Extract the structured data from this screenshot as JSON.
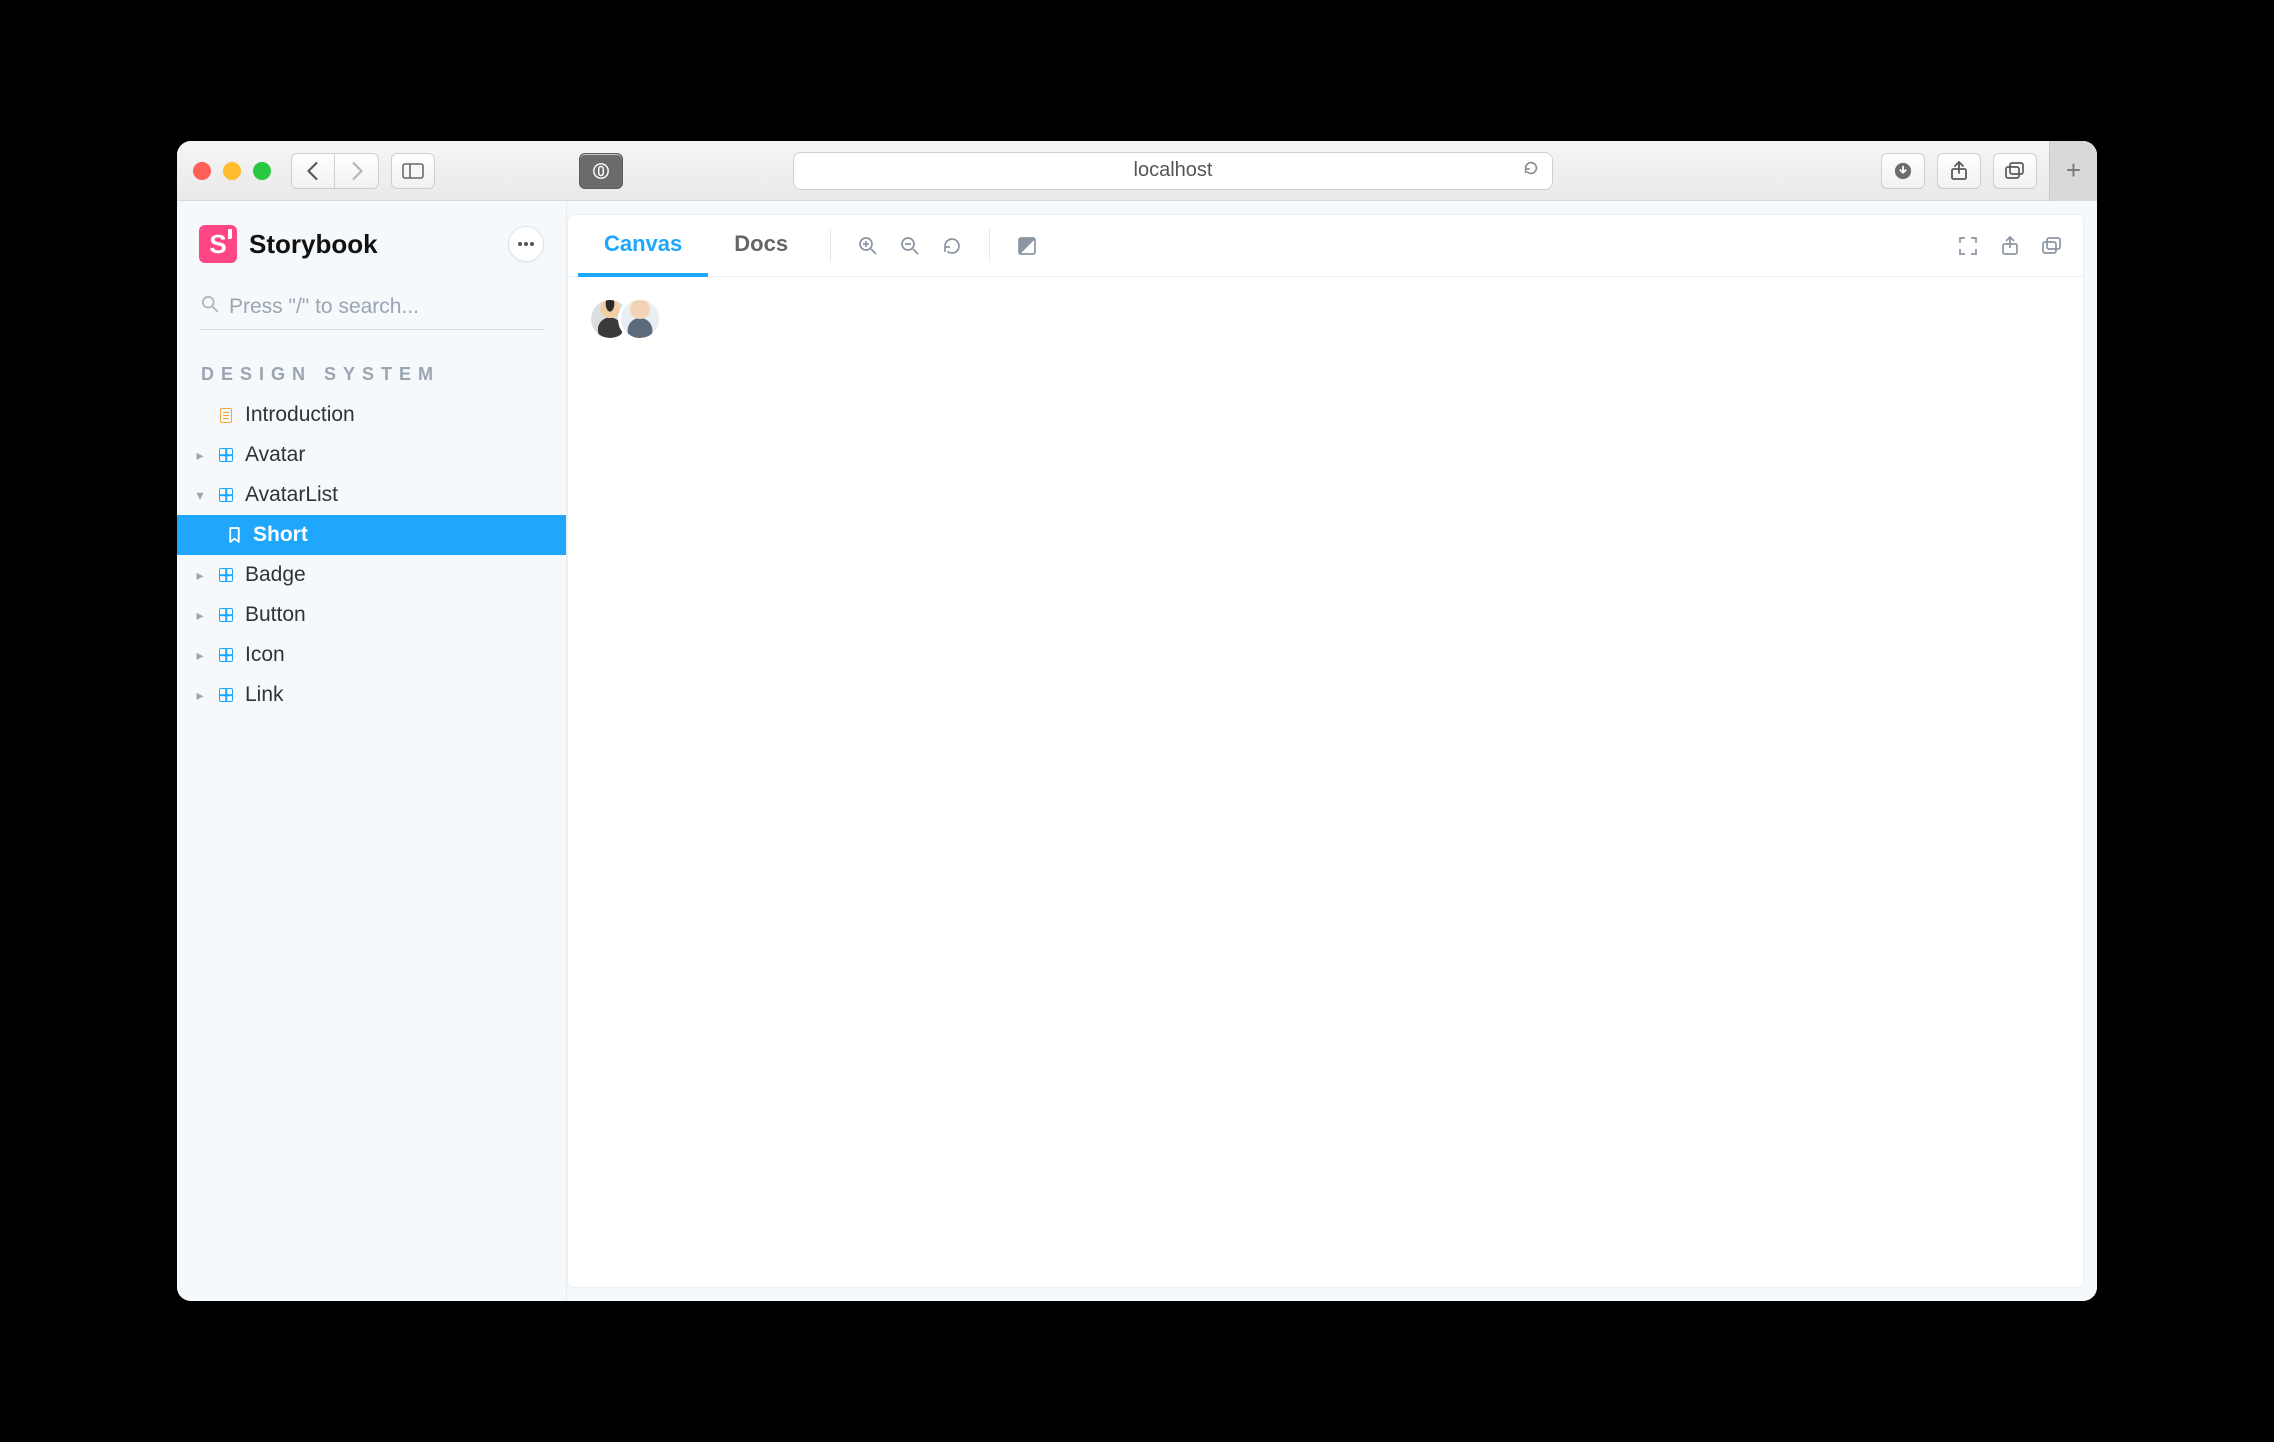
{
  "browser": {
    "address": "localhost"
  },
  "app": {
    "title": "Storybook",
    "search": {
      "placeholder": "Press \"/\" to search..."
    },
    "section_label": "DESIGN SYSTEM",
    "nav": {
      "introduction": "Introduction",
      "avatar": "Avatar",
      "avatarlist": "AvatarList",
      "short": "Short",
      "badge": "Badge",
      "button": "Button",
      "icon": "Icon",
      "link": "Link"
    },
    "tabs": {
      "canvas": "Canvas",
      "docs": "Docs"
    }
  },
  "colors": {
    "accent": "#1ea7fd",
    "brand": "#ff4785"
  }
}
